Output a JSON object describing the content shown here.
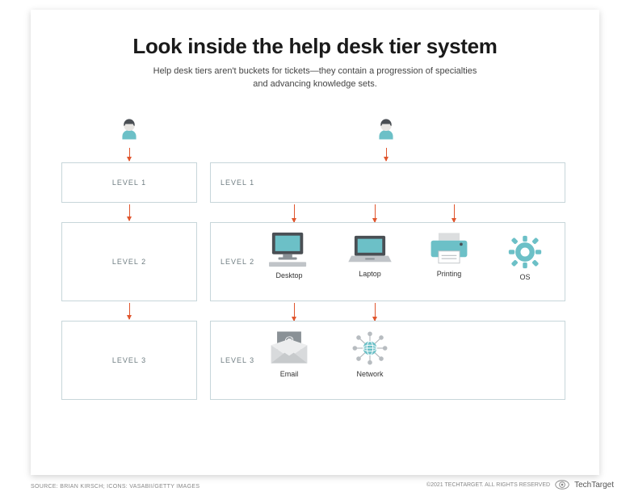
{
  "header": {
    "title": "Look inside the help desk tier system",
    "subtitle_l1": "Help desk tiers aren't buckets for tickets—they contain a progression of specialties",
    "subtitle_l2": "and advancing knowledge sets."
  },
  "columns": {
    "simple": {
      "levels": [
        "LEVEL 1",
        "LEVEL 2",
        "LEVEL 3"
      ]
    },
    "detailed": {
      "levels": [
        "LEVEL 1",
        "LEVEL 2",
        "LEVEL 3"
      ],
      "level2_specialties": [
        {
          "key": "desktop",
          "label": "Desktop"
        },
        {
          "key": "laptop",
          "label": "Laptop"
        },
        {
          "key": "printing",
          "label": "Printing"
        },
        {
          "key": "os",
          "label": "OS"
        }
      ],
      "level3_specialties": [
        {
          "key": "email",
          "label": "Email"
        },
        {
          "key": "network",
          "label": "Network"
        }
      ]
    }
  },
  "footer": {
    "source": "SOURCE: BRIAN KIRSCH; ICONS: VASABII/GETTY IMAGES",
    "copyright": "©2021 TECHTARGET. ALL RIGHTS RESERVED",
    "brand": "TechTarget"
  },
  "palette": {
    "arrow": "#e0562e",
    "tier_border": "#c7d6da",
    "accent_teal": "#6cc0c7",
    "icon_gray": "#8a9196",
    "icon_dark": "#4a4f54"
  }
}
